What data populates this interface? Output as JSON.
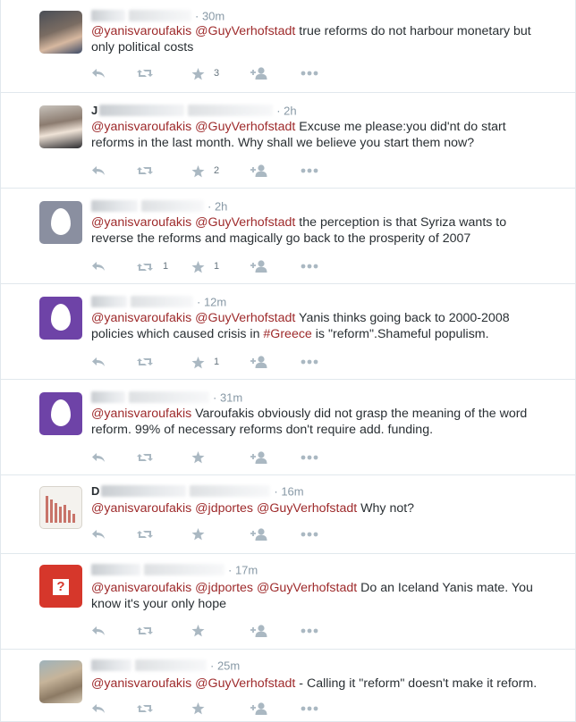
{
  "tweets": [
    {
      "initial": "",
      "time": "30m",
      "mentions": [
        "@yanisvaroufakis",
        "@GuyVerhofstadt"
      ],
      "body": " true reforms do not harbour monetary but only political costs",
      "retweets": "",
      "favorites": "3"
    },
    {
      "initial": "J",
      "time": "2h",
      "mentions": [
        "@yanisvaroufakis",
        "@GuyVerhofstadt"
      ],
      "body": " Excuse me please:you did'nt do start reforms in the last month. Why shall we believe you start them now?",
      "retweets": "",
      "favorites": "2"
    },
    {
      "initial": "",
      "time": "2h",
      "mentions": [
        "@yanisvaroufakis",
        "@GuyVerhofstadt"
      ],
      "body": " the perception is that Syriza wants to reverse the reforms and magically go back to the prosperity of 2007",
      "retweets": "1",
      "favorites": "1"
    },
    {
      "initial": "",
      "time": "12m",
      "mentions": [
        "@yanisvaroufakis",
        "@GuyVerhofstadt"
      ],
      "body_pre": " Yanis thinks going back to 2000-2008 policies which caused crisis in ",
      "hashtag": "#Greece",
      "body_post": " is \"reform\".Shameful populism.",
      "retweets": "",
      "favorites": "1"
    },
    {
      "initial": "",
      "time": "31m",
      "mentions": [
        "@yanisvaroufakis"
      ],
      "body": " Varoufakis obviously did not grasp the meaning of the word reform. 99% of necessary reforms don't require add. funding.",
      "retweets": "",
      "favorites": ""
    },
    {
      "initial": "D",
      "time": "16m",
      "mentions": [
        "@yanisvaroufakis",
        "@jdportes",
        "@GuyVerhofstadt"
      ],
      "body": " Why not?",
      "retweets": "",
      "favorites": ""
    },
    {
      "initial": "",
      "time": "17m",
      "mentions": [
        "@yanisvaroufakis",
        "@jdportes",
        "@GuyVerhofstadt"
      ],
      "body": " Do an Iceland Yanis mate. You know it's your only hope",
      "retweets": "",
      "favorites": ""
    },
    {
      "initial": "",
      "time": "25m",
      "mentions": [
        "@yanisvaroufakis",
        "@GuyVerhofstadt"
      ],
      "body": " - Calling it \"reform\" doesn't make it reform.",
      "retweets": "",
      "favorites": ""
    }
  ],
  "colors": {
    "mention": "#9e2a2b",
    "action_icon": "#aab8c2",
    "meta": "#8899a6"
  },
  "icons": {
    "reply": "reply-icon",
    "retweet": "retweet-icon",
    "favorite": "star-icon",
    "follow": "follow-icon",
    "more": "more-icon"
  }
}
